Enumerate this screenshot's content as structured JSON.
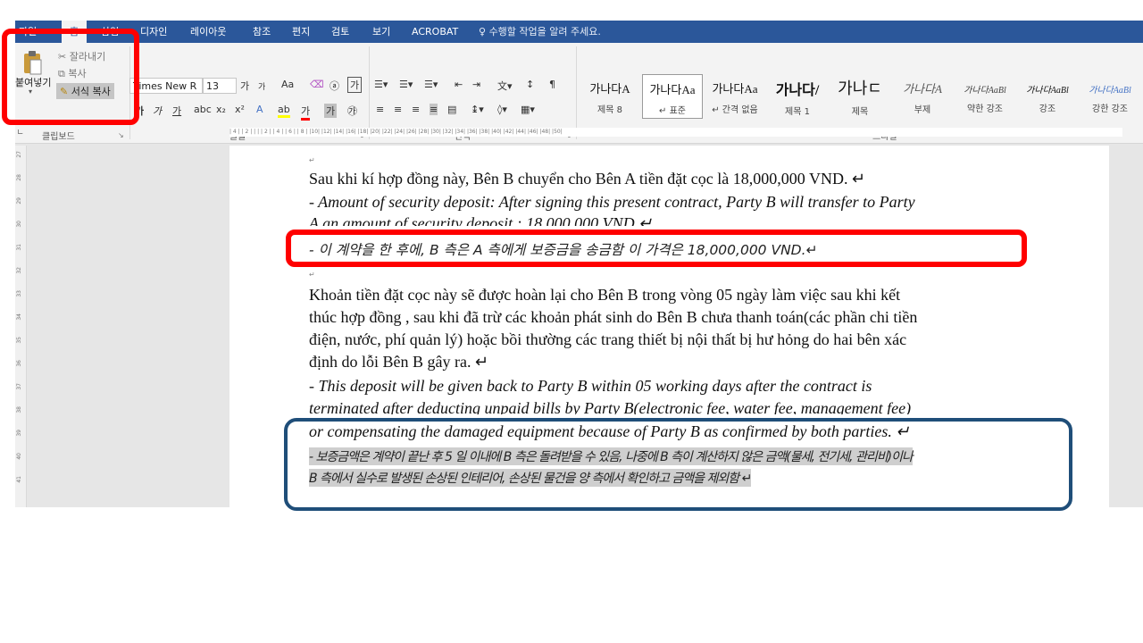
{
  "tabs": [
    "파일",
    "홈",
    "삽입",
    "디자인",
    "레이아웃",
    "참조",
    "편지",
    "검토",
    "보기",
    "ACROBAT"
  ],
  "tell_me": "수행할 작업을 알려 주세요.",
  "clipboard": {
    "paste_label": "붙여넣기",
    "cut_label": "잘라내기",
    "copy_label": "복사",
    "format_painter_label": "서식 복사",
    "group_label": "클립보드"
  },
  "font": {
    "name": "Times New R",
    "size": "13",
    "grow": "가",
    "shrink": "가",
    "case": "Aa",
    "bold": "가",
    "italic": "가",
    "underline": "가",
    "group_label": "글꼴"
  },
  "paragraph": {
    "group_label": "단락"
  },
  "styles": {
    "group_label": "스타일",
    "items": [
      {
        "sample": "가나다A",
        "name": "제목 8"
      },
      {
        "sample": "가나다Aa",
        "name": "↵ 표준"
      },
      {
        "sample": "가나다Aa",
        "name": "↵ 간격 없음"
      },
      {
        "sample": "가나다/",
        "name": "제목 1"
      },
      {
        "sample": "가나ㄷ",
        "name": "제목"
      },
      {
        "sample": "가나다A",
        "name": "부제"
      },
      {
        "sample": "가나다AaBl",
        "name": "약한 강조"
      },
      {
        "sample": "가나다AaBl",
        "name": "강조"
      },
      {
        "sample": "가나다AaBl",
        "name": "강한 강조"
      }
    ]
  },
  "ruler": {
    "h_marks": "| 4 |   | 2 |   |   |   | 2 |   | 4 |   | 6 |   | 8 |   |10|   |12|   |14|   |16|   |18|   |20|   |22|   |24|   |26|   |28|   |30|   |32|   |34|   |36|   |38|   |40|   |42|   |44|   |46|   |48|   |50|",
    "v_marks": [
      "27",
      "28",
      "29",
      "30",
      "31",
      "32",
      "33",
      "34",
      "35",
      "36",
      "37",
      "38",
      "39",
      "40",
      "41"
    ]
  },
  "document": {
    "line1": "Sau khi kí hợp đồng này, Bên B chuyển cho Bên A tiền đặt cọc là 18,000,000 VND. ↵",
    "line2": "- Amount of security deposit: After signing this present contract, Party B will transfer to Party",
    "line3": "A an amount of security deposit : 18,000,000 VND ↵",
    "line4": "- 이 계약을 한 후에, B 측은 A 측에게 보증금을 송금함 이 가격은 18,000,000 VND.↵",
    "line5": "Khoản tiền đặt cọc này sẽ được hoàn lại cho Bên B trong vòng 05 ngày làm việc sau khi kết",
    "line6": "thúc hợp đồng , sau khi đã trừ các khoản phát sinh do Bên B chưa thanh toán(các phần chi tiền",
    "line7": "điện, nước, phí quản lý) hoặc bồi thường các trang thiết bị nội thất bị hư hỏng do hai bên xác",
    "line8": "định do lỗi Bên B gây ra.  ↵",
    "line9": "- This deposit will be given back to Party B within 05 working days after the contract is",
    "line10": "terminated after deducting unpaid bills by Party B(electronic fee, water fee, management fee)",
    "line11": "or compensating the damaged equipment because of Party B as confirmed by both parties.  ↵",
    "line12": "- 보증금액은 계약이 끝난 후 5 일 이내에 B 측은 돌려받을 수 있음, 나중에 B 측이 계산하지 않은 금액(물세, 전기세, 관리비)이나",
    "line13": "B 측에서 실수로 발생된 손상된 인테리어, 손상된 물건을 양 측에서 확인하고 금액을 제외함 ↵",
    "para_mark": "↵"
  },
  "colors": {
    "title_bar": "#2b579a",
    "annotation_red": "#ff0000",
    "annotation_blue": "#1f4e79"
  }
}
